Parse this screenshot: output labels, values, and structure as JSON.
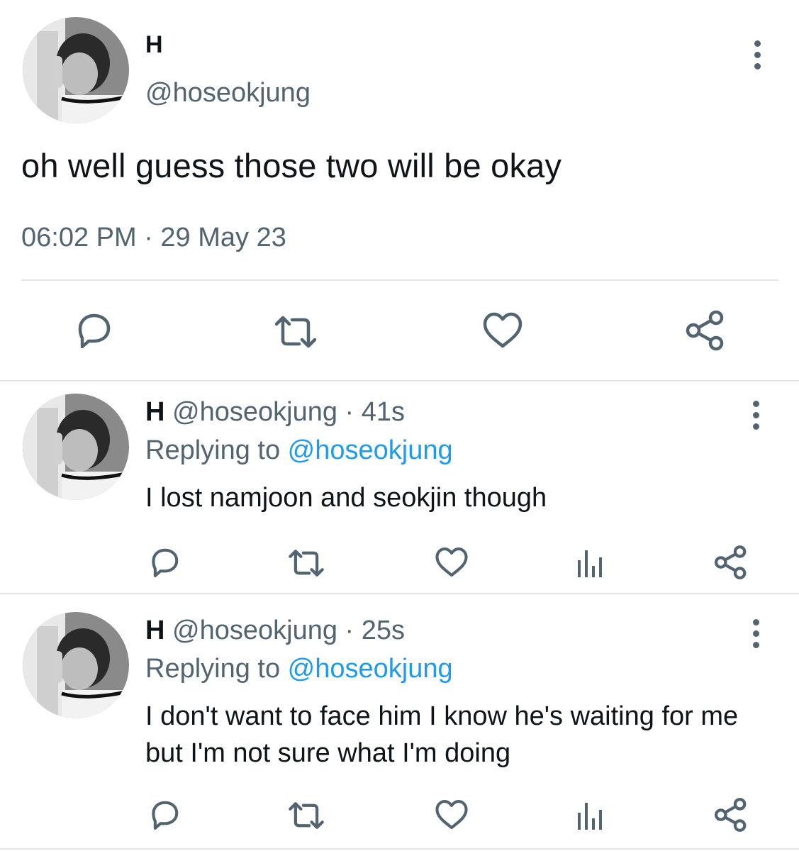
{
  "main_tweet": {
    "name": "H",
    "handle": "@hoseokjung",
    "text": "oh well guess those two will be okay",
    "timestamp": "06:02 PM · 29 May 23",
    "actions": [
      "reply-icon",
      "retweet-icon",
      "like-icon",
      "share-icon"
    ]
  },
  "replies": [
    {
      "name": "H",
      "handle": "@hoseokjung",
      "sep": " · ",
      "time": "41s",
      "replying_prefix": "Replying to ",
      "replying_to": "@hoseokjung",
      "text": "I lost namjoon and seokjin though",
      "actions": [
        "reply-icon",
        "retweet-icon",
        "like-icon",
        "analytics-icon",
        "share-icon"
      ]
    },
    {
      "name": "H",
      "handle": "@hoseokjung",
      "sep": " · ",
      "time": "25s",
      "replying_prefix": "Replying to ",
      "replying_to": "@hoseokjung",
      "text": "I don't want to face him I know he's waiting for me but I'm not sure what I'm doing",
      "actions": [
        "reply-icon",
        "retweet-icon",
        "like-icon",
        "analytics-icon",
        "share-icon"
      ]
    }
  ],
  "colors": {
    "primary_text": "#0f1419",
    "secondary_text": "#536471",
    "link": "#1d9bf0",
    "divider": "#e4e7ea"
  }
}
